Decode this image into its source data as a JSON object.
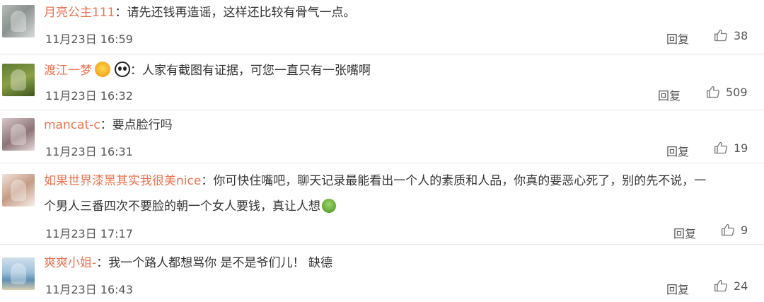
{
  "actions": {
    "reply_label": "回复"
  },
  "comments": [
    {
      "username": "月亮公主111",
      "colon": "：",
      "text": "请先还钱再造谣，这样还比较有骨气一点。",
      "text_line2": "",
      "time": "11月23日 16:59",
      "likes": "38",
      "avatar_icon": "avatar-photo"
    },
    {
      "username": "渡江一梦",
      "colon": "：",
      "text": "人家有截图有证据，可您一直只有一张嘴啊",
      "text_line2": "",
      "time": "11月23日 16:32",
      "likes": "509",
      "avatar_icon": "avatar-photo",
      "badges": [
        "vip-badge-icon",
        "panda-badge-icon"
      ]
    },
    {
      "username": "mancat-c",
      "colon": "：",
      "text": "要点脸行吗",
      "text_line2": "",
      "time": "11月23日 16:31",
      "likes": "19",
      "avatar_icon": "avatar-photo"
    },
    {
      "username": "如果世界漆黑其实我很美nice",
      "colon": "：",
      "text": "你可快住嘴吧，聊天记录最能看出一个人的素质和人品，你真的要恶心死了，别的先不说，一",
      "text_line2": "个男人三番四次不要脸的朝一个女人要钱，真让人想",
      "time": "11月23日 17:17",
      "likes": "9",
      "avatar_icon": "avatar-photo",
      "trailing_emoji": "nauseated-face-icon"
    },
    {
      "username": "爽爽小姐-",
      "colon": "：",
      "text": "我一个路人都想骂你 是不是爷们儿！ 缺德",
      "text_line2": "",
      "time": "11月23日 16:43",
      "likes": "24",
      "avatar_icon": "avatar-photo"
    }
  ]
}
